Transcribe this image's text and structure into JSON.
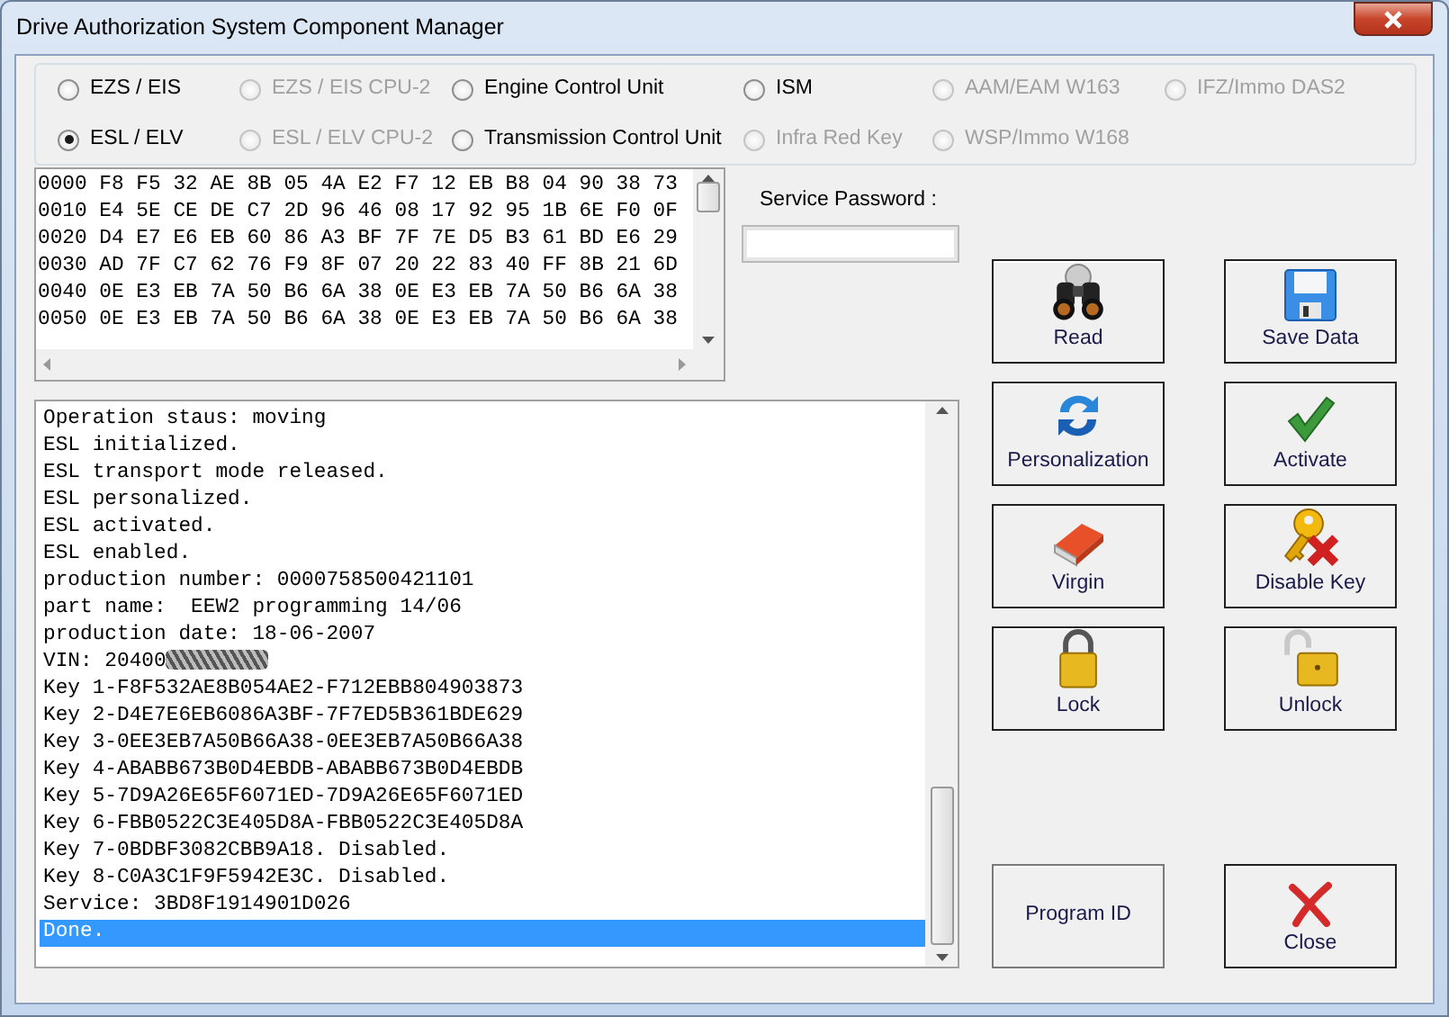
{
  "window": {
    "title": "Drive Authorization System Component Manager"
  },
  "modules": [
    {
      "label": "EZS / EIS",
      "selected": false,
      "disabled": false
    },
    {
      "label": "EZS / EIS CPU-2",
      "selected": false,
      "disabled": true
    },
    {
      "label": "Engine Control Unit",
      "selected": false,
      "disabled": false
    },
    {
      "label": "ISM",
      "selected": false,
      "disabled": false
    },
    {
      "label": "AAM/EAM W163",
      "selected": false,
      "disabled": true
    },
    {
      "label": "IFZ/Immo DAS2",
      "selected": false,
      "disabled": true
    },
    {
      "label": "ESL / ELV",
      "selected": true,
      "disabled": false
    },
    {
      "label": "ESL / ELV CPU-2",
      "selected": false,
      "disabled": true
    },
    {
      "label": "Transmission Control Unit",
      "selected": false,
      "disabled": false
    },
    {
      "label": "Infra Red Key",
      "selected": false,
      "disabled": true
    },
    {
      "label": "WSP/Immo W168",
      "selected": false,
      "disabled": true
    }
  ],
  "hex_dump": [
    "0000 F8 F5 32 AE 8B 05 4A E2 F7 12 EB B8 04 90 38 73",
    "0010 E4 5E CE DE C7 2D 96 46 08 17 92 95 1B 6E F0 0F",
    "0020 D4 E7 E6 EB 60 86 A3 BF 7F 7E D5 B3 61 BD E6 29",
    "0030 AD 7F C7 62 76 F9 8F 07 20 22 83 40 FF 8B 21 6D",
    "0040 0E E3 EB 7A 50 B6 6A 38 0E E3 EB 7A 50 B6 6A 38",
    "0050 0E E3 EB 7A 50 B6 6A 38 0E E3 EB 7A 50 B6 6A 38"
  ],
  "service_password": {
    "label": "Service Password :"
  },
  "log": [
    {
      "text": "Operation staus: moving",
      "selected": false
    },
    {
      "text": "ESL initialized.",
      "selected": false
    },
    {
      "text": "ESL transport mode released.",
      "selected": false
    },
    {
      "text": "ESL personalized.",
      "selected": false
    },
    {
      "text": "ESL activated.",
      "selected": false
    },
    {
      "text": "ESL enabled.",
      "selected": false
    },
    {
      "text": "production number: 0000758500421101",
      "selected": false
    },
    {
      "text": "part name:  EEW2 programming 14/06",
      "selected": false
    },
    {
      "text": "production date: 18-06-2007",
      "selected": false
    },
    {
      "text": "VIN: 20400",
      "selected": false,
      "redacted": true
    },
    {
      "text": "Key 1-F8F532AE8B054AE2-F712EBB804903873",
      "selected": false
    },
    {
      "text": "Key 2-D4E7E6EB6086A3BF-7F7ED5B361BDE629",
      "selected": false
    },
    {
      "text": "Key 3-0EE3EB7A50B66A38-0EE3EB7A50B66A38",
      "selected": false
    },
    {
      "text": "Key 4-ABABB673B0D4EBDB-ABABB673B0D4EBDB",
      "selected": false
    },
    {
      "text": "Key 5-7D9A26E65F6071ED-7D9A26E65F6071ED",
      "selected": false
    },
    {
      "text": "Key 6-FBB0522C3E405D8A-FBB0522C3E405D8A",
      "selected": false
    },
    {
      "text": "Key 7-0BDBF3082CBB9A18. Disabled.",
      "selected": false
    },
    {
      "text": "Key 8-C0A3C1F9F5942E3C. Disabled.",
      "selected": false
    },
    {
      "text": "Service: 3BD8F1914901D026",
      "selected": false
    },
    {
      "text": "Done.",
      "selected": true
    }
  ],
  "buttons": [
    {
      "label": "Read",
      "kind": "read"
    },
    {
      "label": "Save Data",
      "kind": "save"
    },
    {
      "label": "Personalization",
      "kind": "personalize"
    },
    {
      "label": "Activate",
      "kind": "activate"
    },
    {
      "label": "Virgin",
      "kind": "virgin"
    },
    {
      "label": "Disable Key",
      "kind": "disable_key"
    },
    {
      "label": "Lock",
      "kind": "lock"
    },
    {
      "label": "Unlock",
      "kind": "unlock"
    }
  ],
  "bottom_buttons": [
    {
      "label": "Program ID",
      "kind": "plain"
    },
    {
      "label": "Close",
      "kind": "close"
    }
  ]
}
